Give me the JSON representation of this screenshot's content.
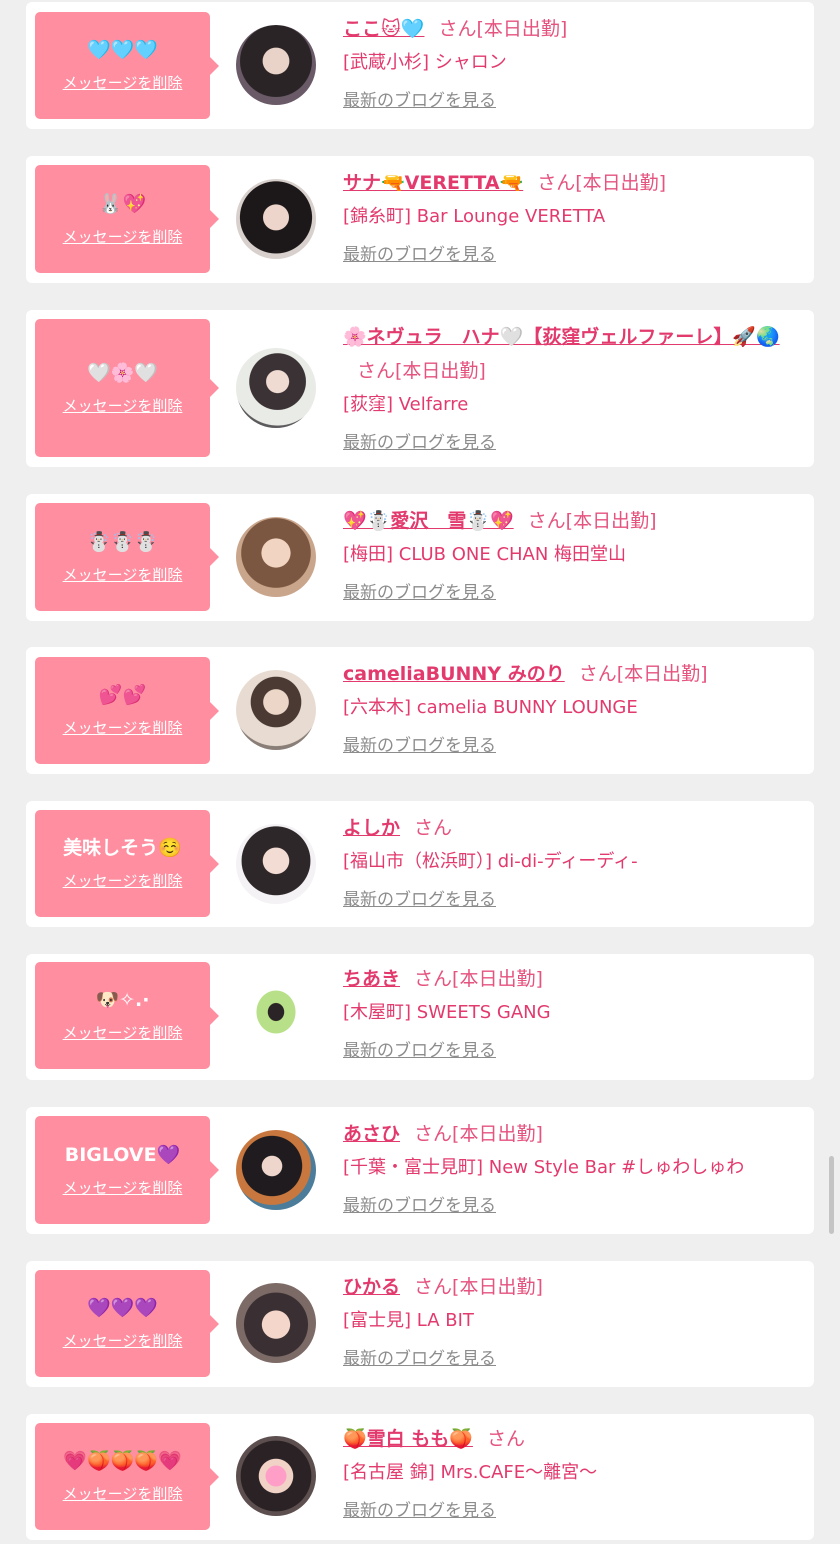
{
  "delete_label": "メッセージを削除",
  "san_label": "さん",
  "blog_label": "最新のブログを見る",
  "colors": {
    "background": "#efefef",
    "bubble": "#fe8ea0",
    "name": "#e33a6e",
    "blog_link": "#8c8c8c"
  },
  "entries": [
    {
      "message": "🩵🩵🩵",
      "name": "ここ🐱🩵",
      "work": "[本日出勤]",
      "shop": "[武蔵小杉] シャロン"
    },
    {
      "message": "🐰💖",
      "name": "サナ🔫VERETTA🔫",
      "work": "[本日出勤]",
      "shop": "[錦糸町] Bar Lounge VERETTA"
    },
    {
      "message": "🤍🌸🤍",
      "name": "🌸ネヴュラ　ハナ🤍【荻窪ヴェルファーレ】🚀🌏",
      "work": "[本日出勤]",
      "shop": "[荻窪] Velfarre"
    },
    {
      "message": "☃️☃️☃️",
      "name": "💖☃️愛沢　雪☃️💖",
      "work": "[本日出勤]",
      "shop": "[梅田] CLUB ONE CHAN 梅田堂山"
    },
    {
      "message": "💕💕",
      "name": "cameliaBUNNY みのり",
      "work": "[本日出勤]",
      "shop": "[六本木] camelia BUNNY LOUNGE"
    },
    {
      "message": "美味しそう☺️",
      "name": "よしか",
      "work": "",
      "shop": "[福山市（松浜町）] di-di-ディーディ-"
    },
    {
      "message": "🐶✧.·",
      "name": "ちあき",
      "work": "[本日出勤]",
      "shop": "[木屋町] SWEETS GANG"
    },
    {
      "message": "BIGLOVE💜",
      "name": "あさひ",
      "work": "[本日出勤]",
      "shop": "[千葉・富士見町] New Style Bar #しゅわしゅわ"
    },
    {
      "message": "💜💜💜",
      "name": "ひかる",
      "work": "[本日出勤]",
      "shop": "[富士見] LA BIT"
    },
    {
      "message": "💗🍑🍑🍑💗",
      "name": "🍑雪白 もも🍑",
      "work": "",
      "shop": "[名古屋 錦] Mrs.CAFE〜離宮〜"
    }
  ]
}
